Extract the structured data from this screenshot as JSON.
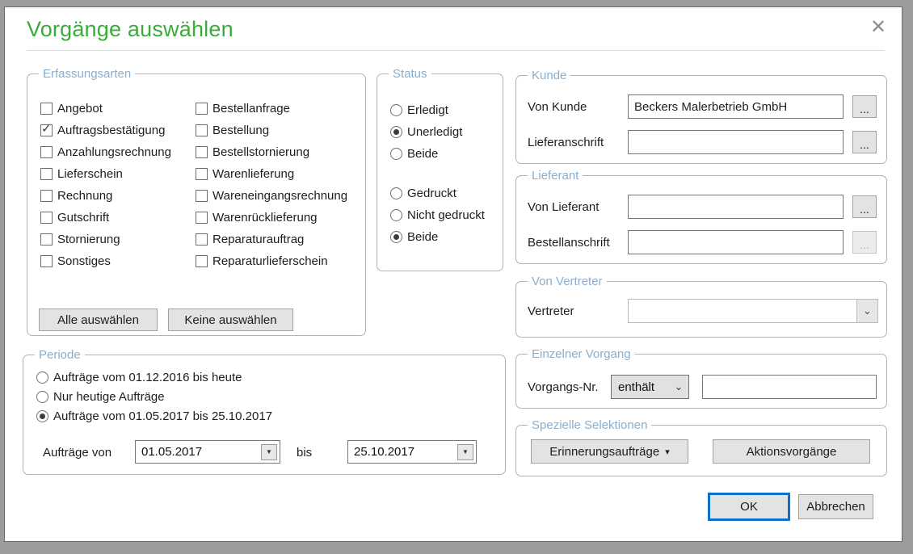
{
  "dialog": {
    "title": "Vorgänge auswählen"
  },
  "icons": {
    "close": "✕",
    "check": "✓",
    "browse": "...",
    "chevron_down": "⌄",
    "dropdown_arrow": "▼",
    "menu_arrow": "▾"
  },
  "colors": {
    "title_green": "#3aac3a",
    "group_label_blue": "#8aaecb",
    "focus_blue": "#0e70c8",
    "frame_gray": "#9c9c9c"
  },
  "erfassungsarten": {
    "label": "Erfassungsarten",
    "left": [
      {
        "label": "Angebot",
        "checked": false
      },
      {
        "label": "Auftragsbestätigung",
        "checked": true
      },
      {
        "label": "Anzahlungsrechnung",
        "checked": false
      },
      {
        "label": "Lieferschein",
        "checked": false
      },
      {
        "label": "Rechnung",
        "checked": false
      },
      {
        "label": "Gutschrift",
        "checked": false
      },
      {
        "label": "Stornierung",
        "checked": false
      },
      {
        "label": "Sonstiges",
        "checked": false
      }
    ],
    "right": [
      {
        "label": "Bestellanfrage",
        "checked": false
      },
      {
        "label": "Bestellung",
        "checked": false
      },
      {
        "label": "Bestellstornierung",
        "checked": false
      },
      {
        "label": "Warenlieferung",
        "checked": false
      },
      {
        "label": "Wareneingangsrechnung",
        "checked": false
      },
      {
        "label": "Warenrücklieferung",
        "checked": false
      },
      {
        "label": "Reparaturauftrag",
        "checked": false
      },
      {
        "label": "Reparaturlieferschein",
        "checked": false
      }
    ],
    "select_all_label": "Alle auswählen",
    "select_none_label": "Keine auswählen"
  },
  "status": {
    "label": "Status",
    "done_group": [
      {
        "label": "Erledigt",
        "selected": false
      },
      {
        "label": "Unerledigt",
        "selected": true
      },
      {
        "label": "Beide",
        "selected": false
      }
    ],
    "printed_group": [
      {
        "label": "Gedruckt",
        "selected": false
      },
      {
        "label": "Nicht gedruckt",
        "selected": false
      },
      {
        "label": "Beide",
        "selected": true
      }
    ]
  },
  "kunde": {
    "label": "Kunde",
    "von_kunde_label": "Von Kunde",
    "von_kunde_value": "Beckers Malerbetrieb GmbH",
    "lieferanschrift_label": "Lieferanschrift",
    "lieferanschrift_value": ""
  },
  "lieferant": {
    "label": "Lieferant",
    "von_lieferant_label": "Von Lieferant",
    "von_lieferant_value": "",
    "bestellanschrift_label": "Bestellanschrift",
    "bestellanschrift_value": ""
  },
  "von_vertreter": {
    "label": "Von Vertreter",
    "vertreter_label": "Vertreter",
    "vertreter_value": ""
  },
  "einzelner_vorgang": {
    "label": "Einzelner Vorgang",
    "vorgangs_nr_label": "Vorgangs-Nr.",
    "operator_value": "enthält",
    "number_value": ""
  },
  "spezielle_selektionen": {
    "label": "Spezielle Selektionen",
    "erinnerung_label": "Erinnerungsaufträge",
    "aktion_label": "Aktionsvorgänge"
  },
  "periode": {
    "label": "Periode",
    "options": [
      {
        "label": "Aufträge vom 01.12.2016 bis heute",
        "selected": false
      },
      {
        "label": "Nur heutige Aufträge",
        "selected": false
      },
      {
        "label": "Aufträge vom 01.05.2017 bis 25.10.2017",
        "selected": true
      }
    ],
    "von_label": "Aufträge von",
    "von_value": "01.05.2017",
    "bis_label": "bis",
    "bis_value": "25.10.2017"
  },
  "footer": {
    "ok_label": "OK",
    "cancel_label": "Abbrechen"
  }
}
